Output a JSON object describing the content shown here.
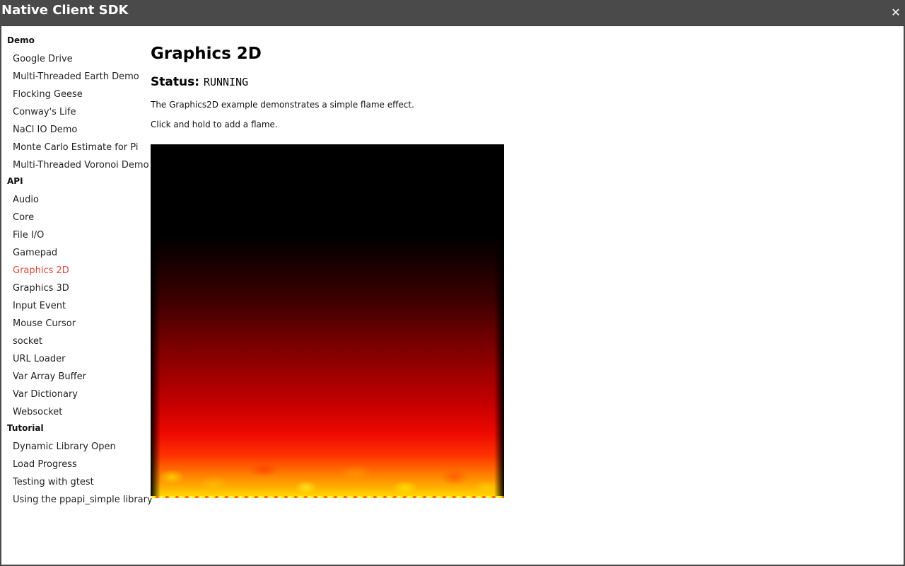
{
  "window": {
    "title": "Native Client SDK",
    "close_glyph": "✕",
    "close_icon": "close-icon"
  },
  "sidebar": {
    "groups": [
      {
        "label": "Demo",
        "items": [
          {
            "label": "Google Drive"
          },
          {
            "label": "Multi-Threaded Earth Demo"
          },
          {
            "label": "Flocking Geese"
          },
          {
            "label": "Conway's Life"
          },
          {
            "label": "NaCl IO Demo"
          },
          {
            "label": "Monte Carlo Estimate for Pi"
          },
          {
            "label": "Multi-Threaded Voronoi Demo"
          }
        ]
      },
      {
        "label": "API",
        "items": [
          {
            "label": "Audio"
          },
          {
            "label": "Core"
          },
          {
            "label": "File I/O"
          },
          {
            "label": "Gamepad"
          },
          {
            "label": "Graphics 2D"
          },
          {
            "label": "Graphics 3D"
          },
          {
            "label": "Input Event"
          },
          {
            "label": "Mouse Cursor"
          },
          {
            "label": "socket"
          },
          {
            "label": "URL Loader"
          },
          {
            "label": "Var Array Buffer"
          },
          {
            "label": "Var Dictionary"
          },
          {
            "label": "Websocket"
          }
        ]
      },
      {
        "label": "Tutorial",
        "items": [
          {
            "label": "Dynamic Library Open"
          },
          {
            "label": "Load Progress"
          },
          {
            "label": "Testing with gtest"
          },
          {
            "label": "Using the ppapi_simple library"
          }
        ]
      }
    ],
    "active_item": "Graphics 2D",
    "active_color": "#dd4b39"
  },
  "main": {
    "title": "Graphics 2D",
    "status_label": "Status:",
    "status_value": "RUNNING",
    "description": "The Graphics2D example demonstrates a simple flame effect.",
    "instruction": "Click and hold to add a flame."
  },
  "colors": {
    "titlebar": "#4a4a4a",
    "accent": "#dd4b39",
    "canvas_bg": "#000000"
  }
}
